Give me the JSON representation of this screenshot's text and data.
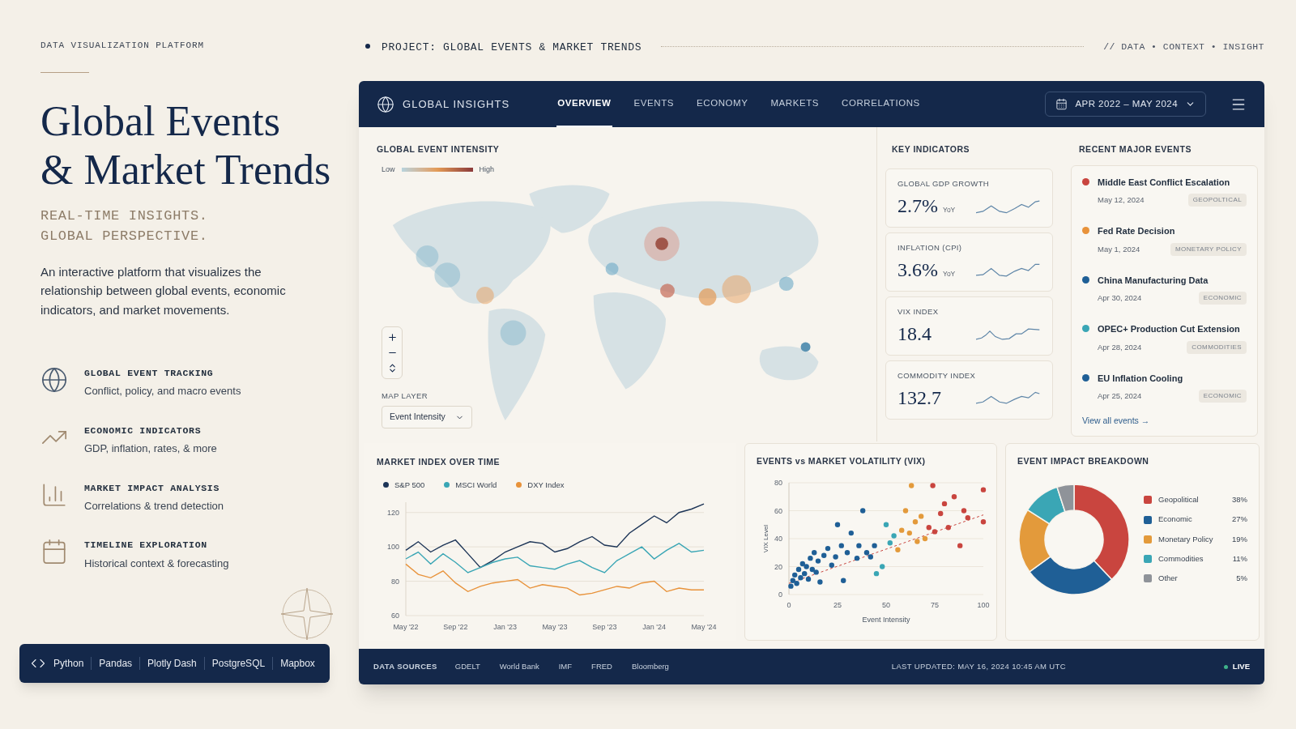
{
  "page_header": {
    "label": "DATA VISUALIZATION PLATFORM",
    "project": "PROJECT: GLOBAL EVENTS & MARKET TRENDS",
    "tagline": "// DATA • CONTEXT • INSIGHT"
  },
  "hero": {
    "title_lines": [
      "Global Events",
      "& Market Trends"
    ],
    "subtitle_lines": [
      "REAL-TIME INSIGHTS.",
      "GLOBAL PERSPECTIVE."
    ],
    "description": "An interactive platform that visualizes the relationship between global events, economic indicators, and market movements."
  },
  "features": [
    {
      "title": "GLOBAL EVENT TRACKING",
      "subtitle": "Conflict, policy, and macro events"
    },
    {
      "title": "ECONOMIC INDICATORS",
      "subtitle": "GDP, inflation, rates, & more"
    },
    {
      "title": "MARKET IMPACT ANALYSIS",
      "subtitle": "Correlations & trend detection"
    },
    {
      "title": "TIMELINE EXPLORATION",
      "subtitle": "Historical context & forecasting"
    }
  ],
  "tech_stack": [
    "Python",
    "Pandas",
    "Plotly Dash",
    "PostgreSQL",
    "Mapbox"
  ],
  "dashboard": {
    "brand": "GLOBAL INSIGHTS",
    "tabs": [
      {
        "label": "OVERVIEW",
        "selected": true
      },
      {
        "label": "EVENTS",
        "selected": false
      },
      {
        "label": "ECONOMY",
        "selected": false
      },
      {
        "label": "MARKETS",
        "selected": false
      },
      {
        "label": "CORRELATIONS",
        "selected": false
      }
    ],
    "date_range": "APR 2022 – MAY 2024",
    "map": {
      "title": "GLOBAL EVENT INTENSITY",
      "legend_low": "Low",
      "legend_high": "High",
      "layer_label": "MAP LAYER",
      "layer_value": "Event Intensity"
    },
    "key_indicators": {
      "title": "KEY INDICATORS",
      "items": [
        {
          "label": "GLOBAL GDP GROWTH",
          "value": "2.7%",
          "unit": "YoY"
        },
        {
          "label": "INFLATION (CPI)",
          "value": "3.6%",
          "unit": "YoY"
        },
        {
          "label": "VIX INDEX",
          "value": "18.4"
        },
        {
          "label": "COMMODITY INDEX",
          "value": "132.7"
        }
      ]
    },
    "recent_events": {
      "title": "RECENT MAJOR EVENTS",
      "items": [
        {
          "title": "Middle East Conflict Escalation",
          "date": "May 12, 2024",
          "tag": "GEOPOLTICAL",
          "color": "#c9453f"
        },
        {
          "title": "Fed Rate Decision",
          "date": "May 1, 2024",
          "tag": "MONETARY POLICY",
          "color": "#e8923a"
        },
        {
          "title": "China Manufacturing Data",
          "date": "Apr 30, 2024",
          "tag": "ECONOMIC",
          "color": "#1f5f96"
        },
        {
          "title": "OPEC+ Production Cut Extension",
          "date": "Apr 28, 2024",
          "tag": "COMMODITIES",
          "color": "#3aa6b5"
        },
        {
          "title": "EU Inflation Cooling",
          "date": "Apr 25, 2024",
          "tag": "ECONOMIC",
          "color": "#1f5f96"
        }
      ],
      "link": "View all events →"
    },
    "market_index": {
      "title": "MARKET INDEX OVER TIME",
      "chart_data": {
        "type": "line",
        "categories": [
          "May '22",
          null,
          null,
          null,
          "Sep '22",
          null,
          null,
          null,
          "Jan '23",
          null,
          null,
          null,
          "May '23",
          null,
          null,
          null,
          "Sep '23",
          null,
          null,
          null,
          "Jan '24",
          null,
          null,
          null,
          "May '24"
        ],
        "grid": true,
        "yticks": [
          60,
          80,
          100,
          120
        ],
        "ylim": [
          60,
          126
        ],
        "series": [
          {
            "name": "S&P 500",
            "color": "#1d3557",
            "values": [
              98,
              103,
              97,
              101,
              104,
              96,
              88,
              92,
              97,
              100,
              103,
              102,
              97,
              99,
              103,
              106,
              101,
              100,
              108,
              113,
              118,
              114,
              120,
              122,
              125
            ]
          },
          {
            "name": "MSCI World",
            "color": "#3aa6b5",
            "values": [
              93,
              97,
              90,
              96,
              91,
              85,
              88,
              91,
              93,
              94,
              89,
              88,
              87,
              90,
              92,
              88,
              85,
              92,
              96,
              100,
              93,
              98,
              102,
              97,
              98
            ]
          },
          {
            "name": "DXY Index",
            "color": "#e8923a",
            "values": [
              90,
              84,
              82,
              86,
              79,
              74,
              77,
              79,
              80,
              81,
              76,
              78,
              77,
              76,
              72,
              73,
              75,
              77,
              76,
              79,
              80,
              74,
              76,
              75,
              75
            ]
          }
        ]
      }
    },
    "scatter": {
      "title": "EVENTS vs MARKET VOLATILITY (VIX)",
      "chart_data": {
        "type": "scatter",
        "xlabel": "Event Intensity",
        "ylabel": "VIX Level",
        "xlim": [
          0,
          100
        ],
        "ylim": [
          0,
          80
        ],
        "grid": true,
        "xticks": [
          0,
          25,
          50,
          75,
          100
        ],
        "yticks": [
          0,
          20,
          40,
          60,
          80
        ],
        "series": [
          {
            "color": "#1f5f96",
            "x": [
              1,
              2,
              3,
              4,
              5,
              6,
              7,
              8,
              9,
              10,
              11,
              12,
              13,
              14,
              15,
              16,
              18,
              20,
              22,
              24,
              25,
              27,
              28,
              30,
              32,
              35,
              36,
              38,
              40,
              42,
              44
            ],
            "values": [
              6,
              10,
              14,
              8,
              18,
              12,
              22,
              15,
              20,
              11,
              26,
              18,
              30,
              16,
              24,
              9,
              28,
              33,
              21,
              27,
              50,
              35,
              10,
              30,
              44,
              26,
              35,
              60,
              30,
              27,
              35
            ]
          },
          {
            "color": "#3aa6b5",
            "x": [
              45,
              48,
              50,
              52,
              54
            ],
            "values": [
              15,
              20,
              50,
              37,
              42
            ]
          },
          {
            "color": "#e39a3b",
            "x": [
              56,
              58,
              60,
              62,
              63,
              65,
              66,
              68,
              70
            ],
            "values": [
              32,
              46,
              60,
              44,
              78,
              52,
              38,
              56,
              40
            ]
          },
          {
            "color": "#c9453f",
            "x": [
              72,
              74,
              75,
              78,
              80,
              82,
              85,
              88,
              90,
              92,
              100,
              100
            ],
            "values": [
              48,
              78,
              45,
              58,
              65,
              48,
              70,
              35,
              60,
              55,
              75,
              52
            ]
          },
          {
            "type": "line",
            "line_style": "dashed",
            "color": "#c9453f",
            "x": [
              0,
              100
            ],
            "values": [
              8,
              57
            ]
          }
        ]
      }
    },
    "impact": {
      "title": "EVENT IMPACT BREAKDOWN",
      "chart_data": {
        "type": "donut",
        "categories": [
          "Geopolitical",
          "Economic",
          "Monetary Policy",
          "Commodities",
          "Other"
        ],
        "values": [
          38,
          27,
          19,
          11,
          5
        ]
      },
      "legend": [
        {
          "value": "38%",
          "color": "#c9453f"
        },
        {
          "value": "27%",
          "color": "#1f5f96"
        },
        {
          "value": "19%",
          "color": "#e39a3b"
        },
        {
          "value": "11%",
          "color": "#3aa6b5"
        },
        {
          "value": "5%",
          "color": "#8f9399"
        }
      ]
    },
    "footer": {
      "sources_label": "DATA SOURCES",
      "sources": [
        "GDELT",
        "World Bank",
        "IMF",
        "FRED",
        "Bloomberg"
      ],
      "last_updated": "LAST UPDATED: MAY 16, 2024 10:45 AM UTC",
      "live": "LIVE"
    }
  }
}
